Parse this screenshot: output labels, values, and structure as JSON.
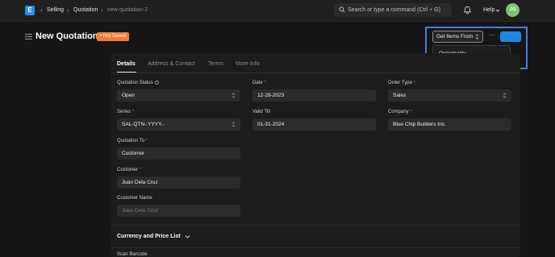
{
  "navbar": {
    "logo_letter": "E",
    "breadcrumbs": [
      "Selling",
      "Quotation",
      "new-quotation-2"
    ],
    "search_placeholder": "Search or type a command (Ctrl + G)",
    "help_label": "Help",
    "avatar_initials": "JG"
  },
  "header": {
    "title": "New Quotation",
    "status_badge": "• Not Saved",
    "get_items_label": "Get Items From",
    "more_label": "···",
    "dropdown_items": [
      "Opportunity"
    ]
  },
  "tabs": [
    "Details",
    "Address & Contact",
    "Terms",
    "More Info"
  ],
  "form": {
    "quotation_status": {
      "label": "Quotation Status",
      "value": "Open"
    },
    "date": {
      "label": "Date",
      "value": "12-28-2023"
    },
    "order_type": {
      "label": "Order Type",
      "value": "Sales"
    },
    "series": {
      "label": "Series",
      "value": "SAL-QTN-.YYYY.-"
    },
    "valid_till": {
      "label": "Valid Till",
      "value": "01-31-2024"
    },
    "company": {
      "label": "Company",
      "value": "Blue Chip Builders Inc."
    },
    "quotation_to": {
      "label": "Quotation To",
      "value": "Customer"
    },
    "customer": {
      "label": "Customer",
      "value": "Juan Dela Cruz"
    },
    "customer_name": {
      "label": "Customer Name",
      "placeholder": "Juan Dela Cruz"
    }
  },
  "sections": {
    "currency_price_list": "Currency and Price List",
    "scan_barcode": "Scan Barcode"
  },
  "colors": {
    "accent": "#2490ef",
    "badge": "#f07c3a",
    "avatar": "#7cc470",
    "highlight_border": "#4f79d6"
  }
}
